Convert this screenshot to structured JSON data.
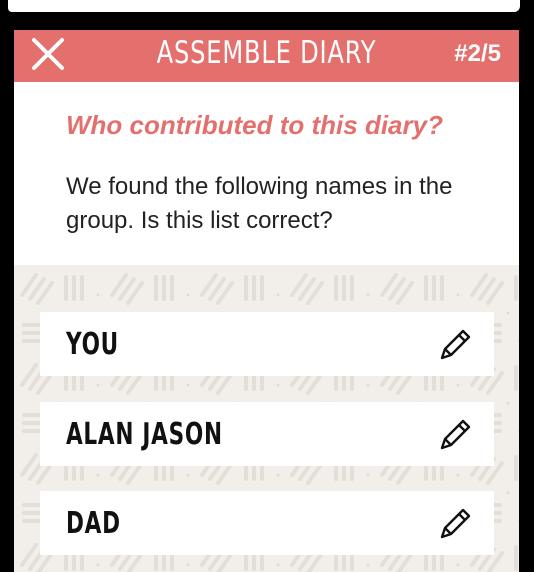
{
  "header": {
    "title": "ASSEMBLE DIARY",
    "step": "#2/5",
    "close_icon": "close-icon",
    "color": "#e4706e"
  },
  "main": {
    "question": "Who contributed to this diary?",
    "description": "We found the following names in the group. Is this list correct?"
  },
  "contributors": [
    {
      "name": "YOU",
      "icon": "pencil-icon"
    },
    {
      "name": "ALAN JASON",
      "icon": "pencil-icon"
    },
    {
      "name": "DAD",
      "icon": "pencil-icon"
    }
  ]
}
